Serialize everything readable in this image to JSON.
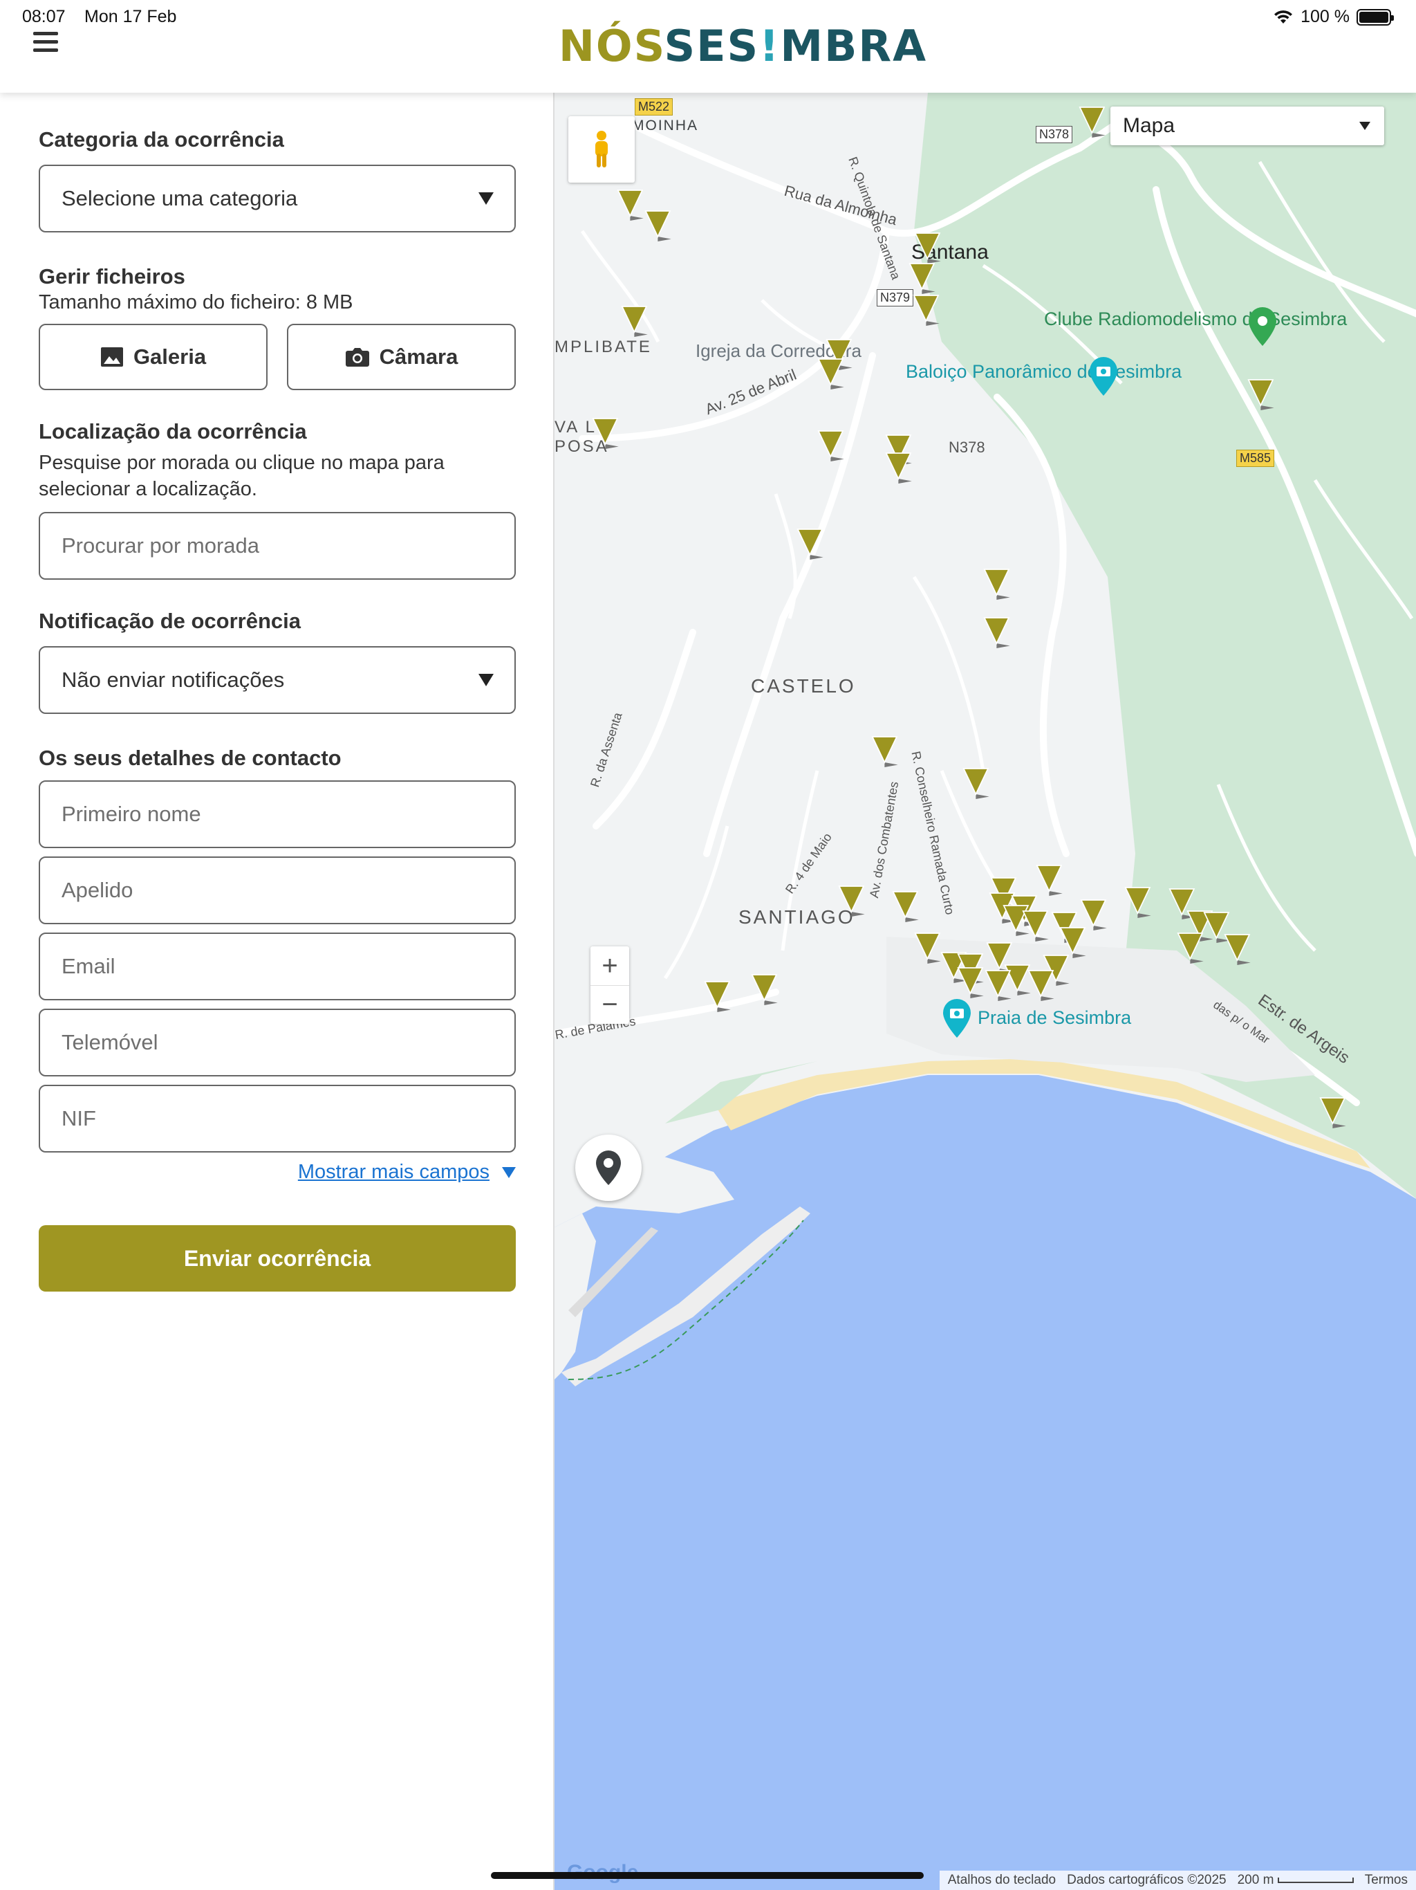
{
  "status_bar": {
    "time": "08:07",
    "date": "Mon 17 Feb",
    "battery": "100 %"
  },
  "header": {
    "logo_part1": "NÓS",
    "logo_part2": "SES",
    "logo_part3": "!",
    "logo_part4": "MBRA"
  },
  "form": {
    "category_label": "Categoria da ocorrência",
    "category_select": "Selecione uma categoria",
    "files_label": "Gerir ficheiros",
    "files_max": "Tamanho máximo do ficheiro: 8 MB",
    "gallery_button": "Galeria",
    "camera_button": "Câmara",
    "location_label": "Localização da ocorrência",
    "location_help": "Pesquise por morada ou clique no mapa para selecionar a localização.",
    "address_placeholder": "Procurar por morada",
    "notification_label": "Notificação de ocorrência",
    "notification_select": "Não enviar notificações",
    "contact_label": "Os seus detalhes de contacto",
    "first_name_placeholder": "Primeiro nome",
    "last_name_placeholder": "Apelido",
    "email_placeholder": "Email",
    "phone_placeholder": "Telemóvel",
    "nif_placeholder": "NIF",
    "more_fields_link": "Mostrar mais campos",
    "submit_button": "Enviar ocorrência"
  },
  "map": {
    "map_type": "Mapa",
    "zoom_in": "+",
    "zoom_out": "−",
    "labels": {
      "moinha": "MOINHA",
      "rua_almoinha": "Rua da Almoinha",
      "santana": "Santana",
      "quintola": "R. Quintola de Santana",
      "clube": "Clube Radiomodelismo de Sesimbra",
      "baloico": "Baloiço Panorâmico de Sesimbra",
      "igreja": "Igreja da Corredoura",
      "mplibate": "MPLIBATE",
      "av25": "Av. 25 de Abril",
      "vala": "VA L POSA",
      "castelo": "CASTELO",
      "santiago": "SANTIAGO",
      "assenta": "R. da Assenta",
      "maio": "R. 4 de Maio",
      "combatentes": "Av. dos Combatentes",
      "conselheiro": "R. Conselheiro Ramada Curto",
      "praia": "Praia de Sesimbra",
      "palames": "R. de Palames",
      "argeis": "Estr. de Argeis",
      "mar": "das p/ o Mar"
    },
    "shields": {
      "m522": "M522",
      "n378a": "N378",
      "n379": "N379",
      "m585": "M585",
      "n378b": "N378"
    },
    "attribution": {
      "shortcuts": "Atalhos do teclado",
      "data": "Dados cartográficos ©2025",
      "scale": "200 m",
      "terms": "Termos",
      "brand": "Google"
    },
    "marker_color": "#9c9520",
    "marker_count": 48
  }
}
